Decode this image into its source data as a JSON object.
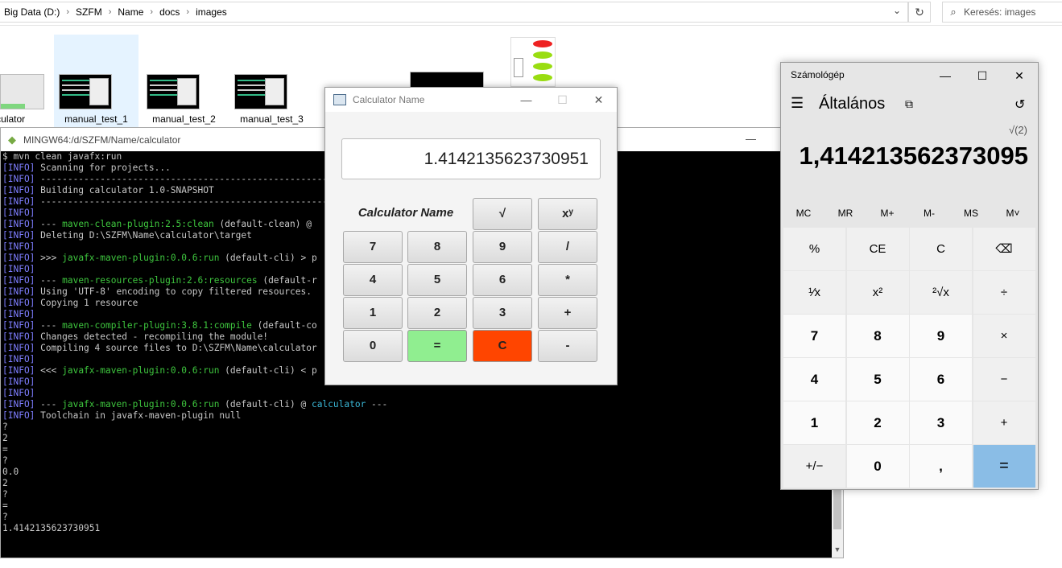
{
  "explorer": {
    "breadcrumb": [
      "Big Data (D:)",
      "SZFM",
      "Name",
      "docs",
      "images"
    ],
    "search_placeholder": "Keresés: images",
    "files": [
      {
        "name": "calculator"
      },
      {
        "name": "manual_test_1"
      },
      {
        "name": "manual_test_2"
      },
      {
        "name": "manual_test_3"
      }
    ]
  },
  "terminal": {
    "title": "MINGW64:/d/SZFM/Name/calculator",
    "lines": [
      [
        {
          "t": "$ mvn clean javafx:run",
          "c": ""
        }
      ],
      [
        {
          "t": "[INFO]",
          "c": "info"
        },
        {
          "t": " Scanning for projects...",
          "c": ""
        }
      ],
      [
        {
          "t": "[INFO]",
          "c": "info"
        },
        {
          "t": " ----------------------------------------------------------------------",
          "c": ""
        }
      ],
      [
        {
          "t": "[INFO]",
          "c": "info"
        },
        {
          "t": " Building calculator 1.0-SNAPSHOT",
          "c": ""
        }
      ],
      [
        {
          "t": "[INFO]",
          "c": "info"
        },
        {
          "t": " ----------------------------------------------------------------------",
          "c": ""
        }
      ],
      [
        {
          "t": "[INFO]",
          "c": "info"
        }
      ],
      [
        {
          "t": "[INFO]",
          "c": "info"
        },
        {
          "t": " --- ",
          "c": ""
        },
        {
          "t": "maven-clean-plugin:2.5:clean",
          "c": "grn"
        },
        {
          "t": " (default-clean) @",
          "c": ""
        }
      ],
      [
        {
          "t": "[INFO]",
          "c": "info"
        },
        {
          "t": " Deleting D:\\SZFM\\Name\\calculator\\target",
          "c": ""
        }
      ],
      [
        {
          "t": "[INFO]",
          "c": "info"
        }
      ],
      [
        {
          "t": "[INFO]",
          "c": "info"
        },
        {
          "t": " >>> ",
          "c": ""
        },
        {
          "t": "javafx-maven-plugin:0.0.6:run",
          "c": "grn"
        },
        {
          "t": " (default-cli) > p",
          "c": ""
        }
      ],
      [
        {
          "t": "[INFO]",
          "c": "info"
        }
      ],
      [
        {
          "t": "[INFO]",
          "c": "info"
        },
        {
          "t": " --- ",
          "c": ""
        },
        {
          "t": "maven-resources-plugin:2.6:resources",
          "c": "grn"
        },
        {
          "t": " (default-r",
          "c": ""
        }
      ],
      [
        {
          "t": "[INFO]",
          "c": "info"
        },
        {
          "t": " Using 'UTF-8' encoding to copy filtered resources.",
          "c": ""
        }
      ],
      [
        {
          "t": "[INFO]",
          "c": "info"
        },
        {
          "t": " Copying 1 resource",
          "c": ""
        }
      ],
      [
        {
          "t": "[INFO]",
          "c": "info"
        }
      ],
      [
        {
          "t": "[INFO]",
          "c": "info"
        },
        {
          "t": " --- ",
          "c": ""
        },
        {
          "t": "maven-compiler-plugin:3.8.1:compile",
          "c": "grn"
        },
        {
          "t": " (default-co",
          "c": ""
        }
      ],
      [
        {
          "t": "[INFO]",
          "c": "info"
        },
        {
          "t": " Changes detected - recompiling the module!",
          "c": ""
        }
      ],
      [
        {
          "t": "[INFO]",
          "c": "info"
        },
        {
          "t": " Compiling 4 source files to D:\\SZFM\\Name\\calculator",
          "c": ""
        }
      ],
      [
        {
          "t": "[INFO]",
          "c": "info"
        }
      ],
      [
        {
          "t": "[INFO]",
          "c": "info"
        },
        {
          "t": " <<< ",
          "c": ""
        },
        {
          "t": "javafx-maven-plugin:0.0.6:run",
          "c": "grn"
        },
        {
          "t": " (default-cli) < p",
          "c": ""
        }
      ],
      [
        {
          "t": "[INFO]",
          "c": "info"
        }
      ],
      [
        {
          "t": "[INFO]",
          "c": "info"
        }
      ],
      [
        {
          "t": "[INFO]",
          "c": "info"
        },
        {
          "t": " --- ",
          "c": ""
        },
        {
          "t": "javafx-maven-plugin:0.0.6:run",
          "c": "grn"
        },
        {
          "t": " (default-cli) @ ",
          "c": ""
        },
        {
          "t": "calculator",
          "c": "cyn"
        },
        {
          "t": " ---",
          "c": ""
        }
      ],
      [
        {
          "t": "[INFO]",
          "c": "info"
        },
        {
          "t": " Toolchain in javafx-maven-plugin null",
          "c": ""
        }
      ],
      [
        {
          "t": "?",
          "c": ""
        }
      ],
      [
        {
          "t": "2",
          "c": ""
        }
      ],
      [
        {
          "t": "=",
          "c": ""
        }
      ],
      [
        {
          "t": "?",
          "c": ""
        }
      ],
      [
        {
          "t": "0.0",
          "c": ""
        }
      ],
      [
        {
          "t": "2",
          "c": ""
        }
      ],
      [
        {
          "t": "?",
          "c": ""
        }
      ],
      [
        {
          "t": "=",
          "c": ""
        }
      ],
      [
        {
          "t": "?",
          "c": ""
        }
      ],
      [
        {
          "t": "1.4142135623730951",
          "c": ""
        }
      ]
    ]
  },
  "java_calc": {
    "title": "Calculator Name",
    "display": "1.4142135623730951",
    "name_label": "Calculator Name",
    "buttons": [
      {
        "label": "√",
        "name": "sqrt-button"
      },
      {
        "label": "xʸ",
        "name": "power-button"
      },
      {
        "label": "7",
        "name": "digit-7-button"
      },
      {
        "label": "8",
        "name": "digit-8-button"
      },
      {
        "label": "9",
        "name": "digit-9-button"
      },
      {
        "label": "/",
        "name": "divide-button"
      },
      {
        "label": "4",
        "name": "digit-4-button"
      },
      {
        "label": "5",
        "name": "digit-5-button"
      },
      {
        "label": "6",
        "name": "digit-6-button"
      },
      {
        "label": "*",
        "name": "multiply-button"
      },
      {
        "label": "1",
        "name": "digit-1-button"
      },
      {
        "label": "2",
        "name": "digit-2-button"
      },
      {
        "label": "3",
        "name": "digit-3-button"
      },
      {
        "label": "+",
        "name": "plus-button"
      },
      {
        "label": "0",
        "name": "digit-0-button"
      },
      {
        "label": "=",
        "name": "equals-button",
        "color": "#90ee90"
      },
      {
        "label": "C",
        "name": "clear-button",
        "color": "#ff4500"
      },
      {
        "label": "-",
        "name": "minus-button"
      }
    ]
  },
  "win_calc": {
    "title": "Számológép",
    "mode": "Általános",
    "expression": "√(2)",
    "result": "1,414213562373095",
    "memory": [
      "MC",
      "MR",
      "M+",
      "M-",
      "MS",
      "M˅"
    ],
    "keys": [
      [
        "%",
        "CE",
        "C",
        "⌫"
      ],
      [
        "¹⁄x",
        "x²",
        "²√x",
        "÷"
      ],
      [
        "7",
        "8",
        "9",
        "×"
      ],
      [
        "4",
        "5",
        "6",
        "−"
      ],
      [
        "1",
        "2",
        "3",
        "+"
      ],
      [
        "+/−",
        "0",
        ",",
        "="
      ]
    ],
    "accent_color": "#8abde6"
  }
}
